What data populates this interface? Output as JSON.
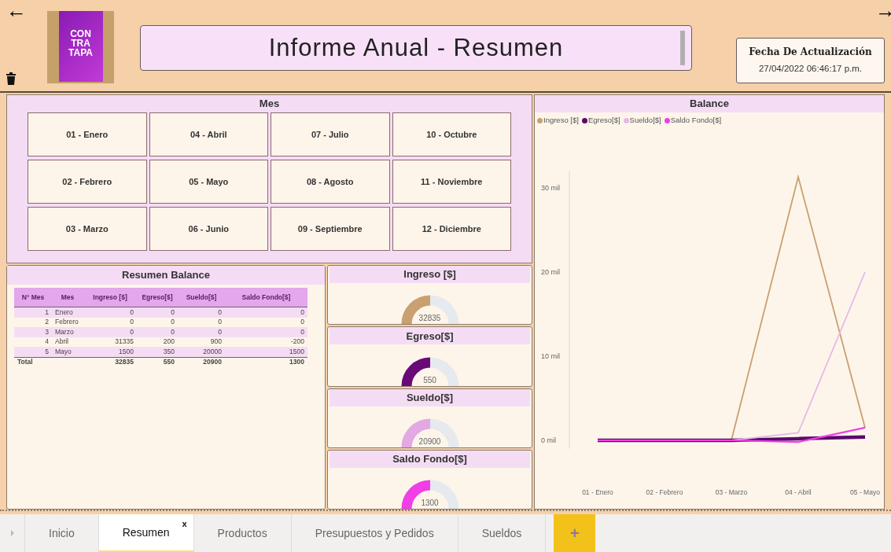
{
  "header": {
    "back": "←",
    "forward": "→",
    "logo_lines": [
      "CON",
      "TRA",
      "TAPA"
    ],
    "title": "Informe Anual - Resumen",
    "date_label": "Fecha De Actualización",
    "date_value": "27/04/2022 06:46:17 p.m."
  },
  "months": {
    "title": "Mes",
    "items": [
      {
        "label": "01 - Enero",
        "selected": false
      },
      {
        "label": "04 - Abril",
        "selected": false
      },
      {
        "label": "07 - Julio",
        "selected": false
      },
      {
        "label": "10 - Octubre",
        "selected": false
      },
      {
        "label": "02 - Febrero",
        "selected": false
      },
      {
        "label": "05 - Mayo",
        "selected": false
      },
      {
        "label": "08 - Agosto",
        "selected": false
      },
      {
        "label": "11 - Noviembre",
        "selected": false
      },
      {
        "label": "03 - Marzo",
        "selected": false
      },
      {
        "label": "06 - Junio",
        "selected": false
      },
      {
        "label": "09 - Septiembre",
        "selected": false
      },
      {
        "label": "12 - Diciembre",
        "selected": false
      }
    ]
  },
  "summary": {
    "title": "Resumen Balance",
    "columns": [
      "N° Mes",
      "Mes",
      "Ingreso [$]",
      "Egreso[$]",
      "Sueldo[$]",
      "Saldo Fondo[$]"
    ],
    "rows": [
      [
        "1",
        "Enero",
        "0",
        "0",
        "0",
        "0"
      ],
      [
        "2",
        "Febrero",
        "0",
        "0",
        "0",
        "0"
      ],
      [
        "3",
        "Marzo",
        "0",
        "0",
        "0",
        "0"
      ],
      [
        "4",
        "Abril",
        "31335",
        "200",
        "900",
        "-200"
      ],
      [
        "5",
        "Mayo",
        "1500",
        "350",
        "20000",
        "1500"
      ]
    ],
    "total": {
      "label": "Total",
      "values": [
        "32835",
        "550",
        "20900",
        "1300"
      ]
    }
  },
  "gauges": [
    {
      "title": "Ingreso [$]",
      "value": "32835",
      "level": 0.5,
      "color": "#c9a06f"
    },
    {
      "title": "Egreso[$]",
      "value": "550",
      "level": 0.5,
      "color": "#6a0a78"
    },
    {
      "title": "Sueldo[$]",
      "value": "20900",
      "level": 0.5,
      "color": "#e2a9e2"
    },
    {
      "title": "Saldo Fondo[$]",
      "value": "1300",
      "level": 0.5,
      "color": "#f03fe6"
    }
  ],
  "balance": {
    "title": "Balance",
    "chart_data": {
      "type": "line",
      "categories": [
        "01 - Enero",
        "02 - Febrero",
        "03 - Marzo",
        "04 - Abril",
        "05 - Mayo"
      ],
      "ylim": [
        -1,
        32
      ],
      "yticks": [
        {
          "value": 0,
          "label": "0 mil"
        },
        {
          "value": 10,
          "label": "10 mil"
        },
        {
          "value": 20,
          "label": "20 mil"
        },
        {
          "value": 30,
          "label": "30 mil"
        }
      ],
      "series": [
        {
          "name": "Ingreso [$]",
          "color": "#c9a06f",
          "values": [
            0,
            0,
            0,
            31.3,
            1.5
          ]
        },
        {
          "name": "Egreso[$]",
          "color": "#5a0a6e",
          "values": [
            0,
            0,
            0,
            0.2,
            0.4
          ]
        },
        {
          "name": "Sueldo[$]",
          "color": "#e6b8e6",
          "values": [
            0,
            0,
            0,
            0.9,
            20
          ]
        },
        {
          "name": "Saldo Fondo[$]",
          "color": "#f03fe6",
          "values": [
            0,
            0,
            0,
            -0.2,
            1.5
          ]
        }
      ]
    }
  },
  "tabs": [
    {
      "label": "Inicio",
      "selected": false
    },
    {
      "label": "Resumen",
      "selected": true,
      "close": "x"
    },
    {
      "label": "Productos",
      "selected": false
    },
    {
      "label": "Presupuestos y Pedidos",
      "selected": false
    },
    {
      "label": "Sueldos",
      "selected": false
    }
  ],
  "add_tab": "+"
}
